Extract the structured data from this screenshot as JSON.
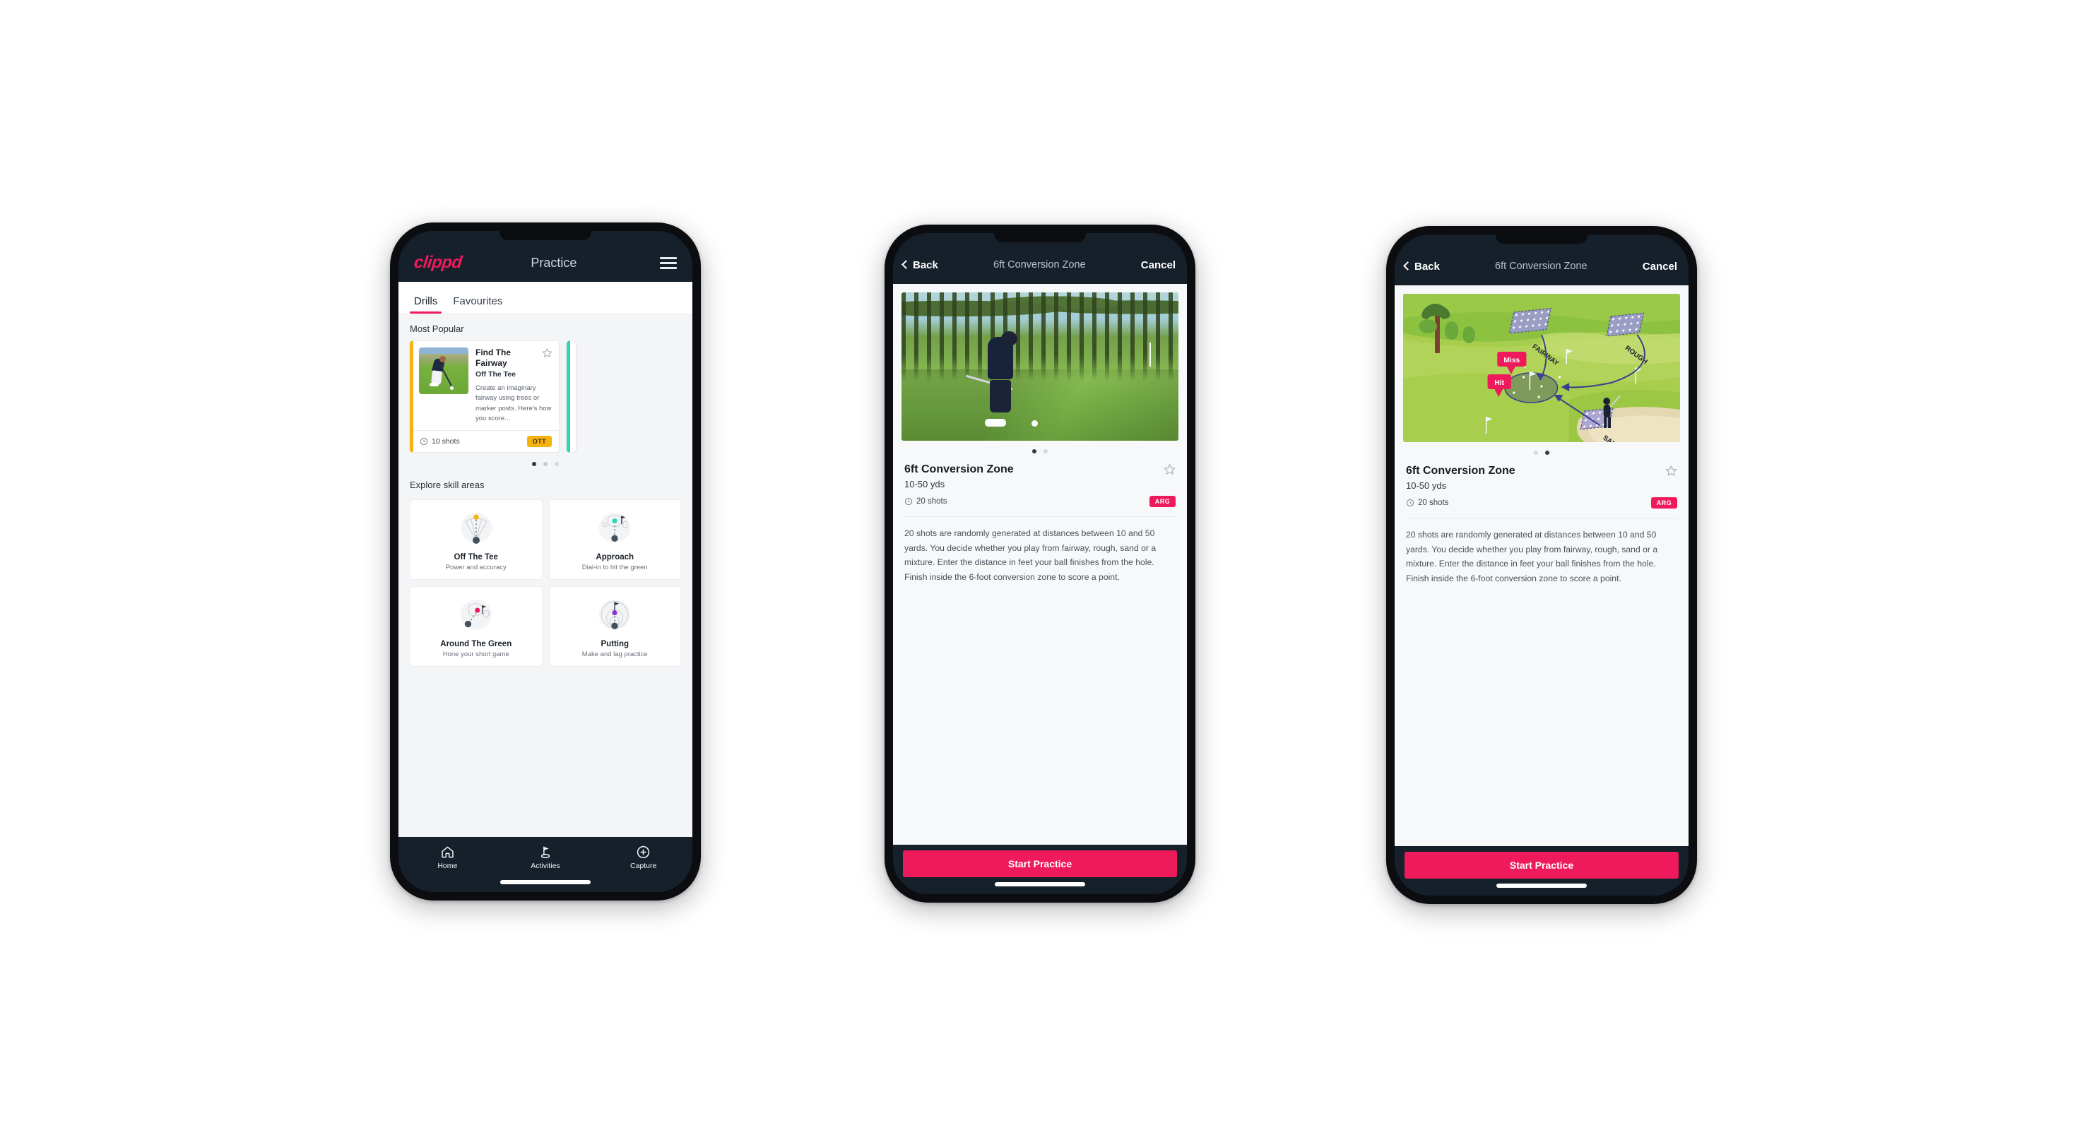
{
  "app": {
    "brand": "clippd",
    "brand_color": "#ef1a5c"
  },
  "phone_practice": {
    "appbar": {
      "logo": "clippd",
      "title": "Practice",
      "menu_icon": "hamburger-menu-icon"
    },
    "tabs": [
      {
        "label": "Drills",
        "active": true
      },
      {
        "label": "Favourites",
        "active": false
      }
    ],
    "most_popular": {
      "section_label": "Most Popular",
      "card": {
        "title": "Find The Fairway",
        "subtitle": "Off The Tee",
        "description": "Create an imaginary fairway using trees or marker posts. Here's how you score...",
        "shots": "10 shots",
        "badge": "OTT",
        "badge_color": "#f5b312",
        "accent_color": "#f5b312",
        "favourite_icon": "star-outline-icon",
        "clock_icon": "clock-icon"
      },
      "next_card_accent_color": "#2fd6b5",
      "carousel_dots": 3,
      "carousel_active_index": 0
    },
    "explore": {
      "section_label": "Explore skill areas",
      "cards": [
        {
          "name": "Off The Tee",
          "desc": "Power and accuracy",
          "icon": "tee-shot-fan-icon",
          "accent": "#f5b312"
        },
        {
          "name": "Approach",
          "desc": "Dial-in to hit the green",
          "icon": "approach-green-icon",
          "accent": "#2fd6b5"
        },
        {
          "name": "Around The Green",
          "desc": "Hone your short game",
          "icon": "around-green-icon",
          "accent": "#ef1a5c"
        },
        {
          "name": "Putting",
          "desc": "Make and lag practice",
          "icon": "putting-rings-icon",
          "accent": "#8b2fd6"
        }
      ]
    },
    "bottom_nav": [
      {
        "label": "Home",
        "icon": "home-icon",
        "active": false
      },
      {
        "label": "Activities",
        "icon": "golf-flag-icon",
        "active": true
      },
      {
        "label": "Capture",
        "icon": "plus-circle-icon",
        "active": false
      }
    ]
  },
  "phone_detail_video": {
    "bar": {
      "back": "Back",
      "title": "6ft Conversion Zone",
      "cancel": "Cancel",
      "back_icon": "chevron-left-icon"
    },
    "media_kind": "video-thumbnail-golfer-chipping",
    "carousel_dots": 2,
    "carousel_active_index": 0,
    "drill": {
      "title": "6ft Conversion Zone",
      "distance": "10-50 yds",
      "shots": "20 shots",
      "badge": "ARG",
      "badge_color": "#ef1a5c",
      "favourite_icon": "star-outline-icon",
      "clock_icon": "clock-icon",
      "description": "20 shots are randomly generated at distances between 10 and 50 yards. You decide whether you play from fairway, rough, sand or a mixture. Enter the distance in feet your ball finishes from the hole. Finish inside the 6-foot conversion zone to score a point."
    },
    "cta": "Start Practice"
  },
  "phone_detail_map": {
    "bar": {
      "back": "Back",
      "title": "6ft Conversion Zone",
      "cancel": "Cancel",
      "back_icon": "chevron-left-icon"
    },
    "media_kind": "course-diagram-illustration",
    "map_labels": {
      "fairway": "FAIRWAY",
      "rough": "ROUGH",
      "sand": "SAND",
      "miss": "Miss",
      "hit": "Hit"
    },
    "carousel_dots": 2,
    "carousel_active_index": 1,
    "drill": {
      "title": "6ft Conversion Zone",
      "distance": "10-50 yds",
      "shots": "20 shots",
      "badge": "ARG",
      "badge_color": "#ef1a5c",
      "favourite_icon": "star-outline-icon",
      "clock_icon": "clock-icon",
      "description": "20 shots are randomly generated at distances between 10 and 50 yards. You decide whether you play from fairway, rough, sand or a mixture. Enter the distance in feet your ball finishes from the hole. Finish inside the 6-foot conversion zone to score a point."
    },
    "cta": "Start Practice"
  }
}
